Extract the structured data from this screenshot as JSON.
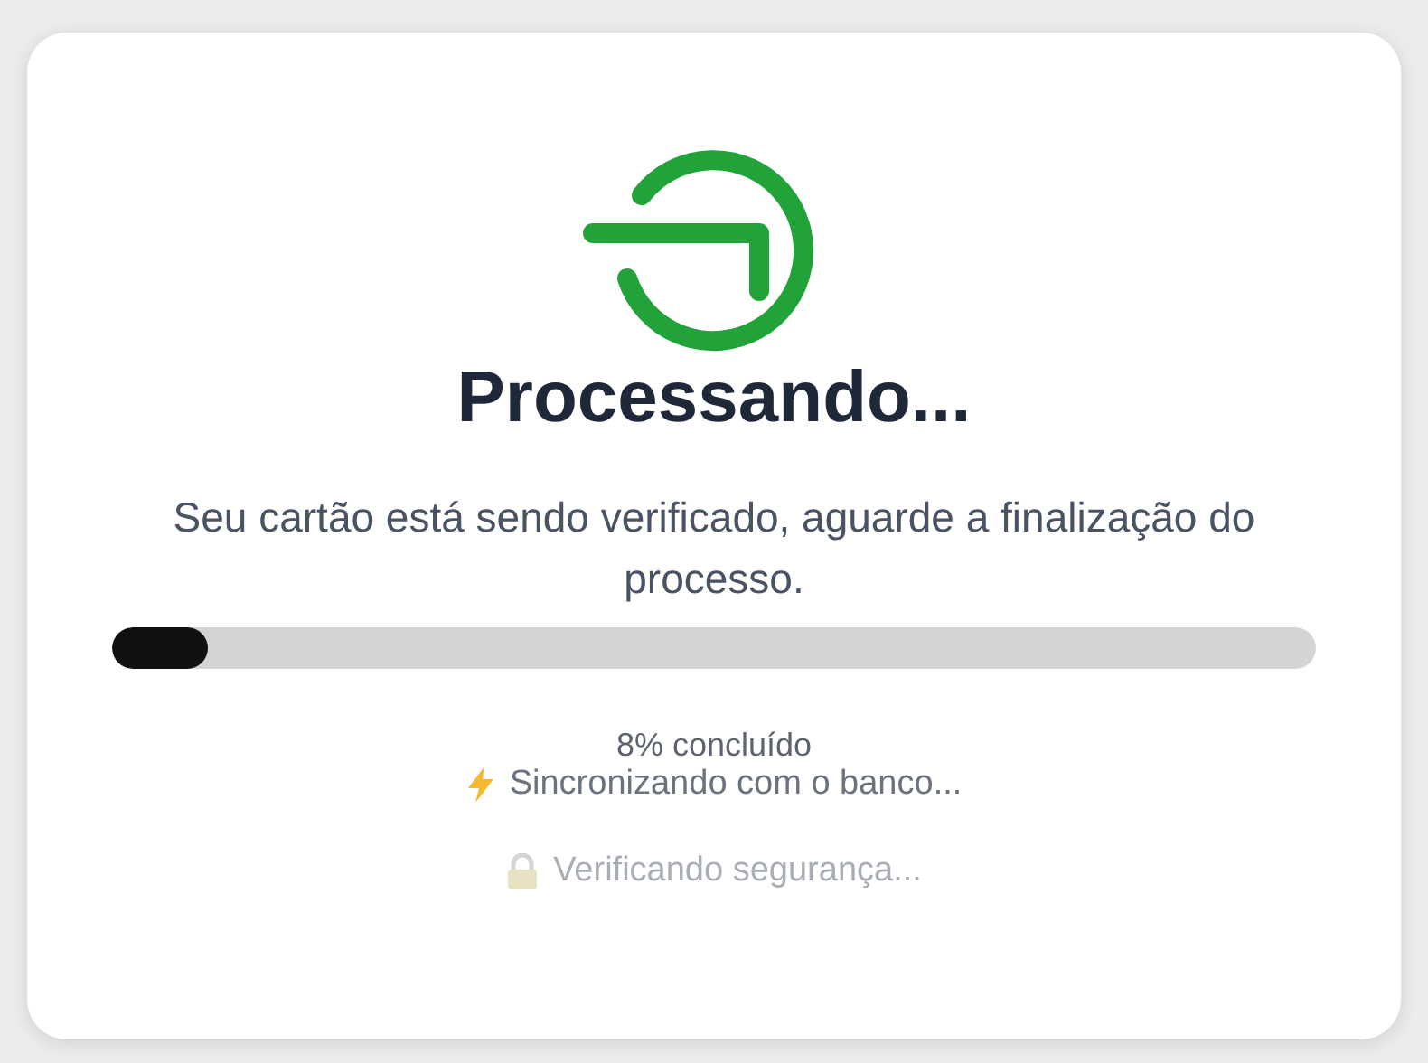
{
  "title": "Processando...",
  "message": "Seu cartão está sendo verificado, aguarde a finalização do processo.",
  "progress": {
    "level": 0.08,
    "reading": "8% concluído"
  },
  "steps": [
    {
      "kind": "sync",
      "text": "Sincronizando com o banco...",
      "active": true
    },
    {
      "kind": "security",
      "text": "Verificando segurança...",
      "active": false
    }
  ]
}
